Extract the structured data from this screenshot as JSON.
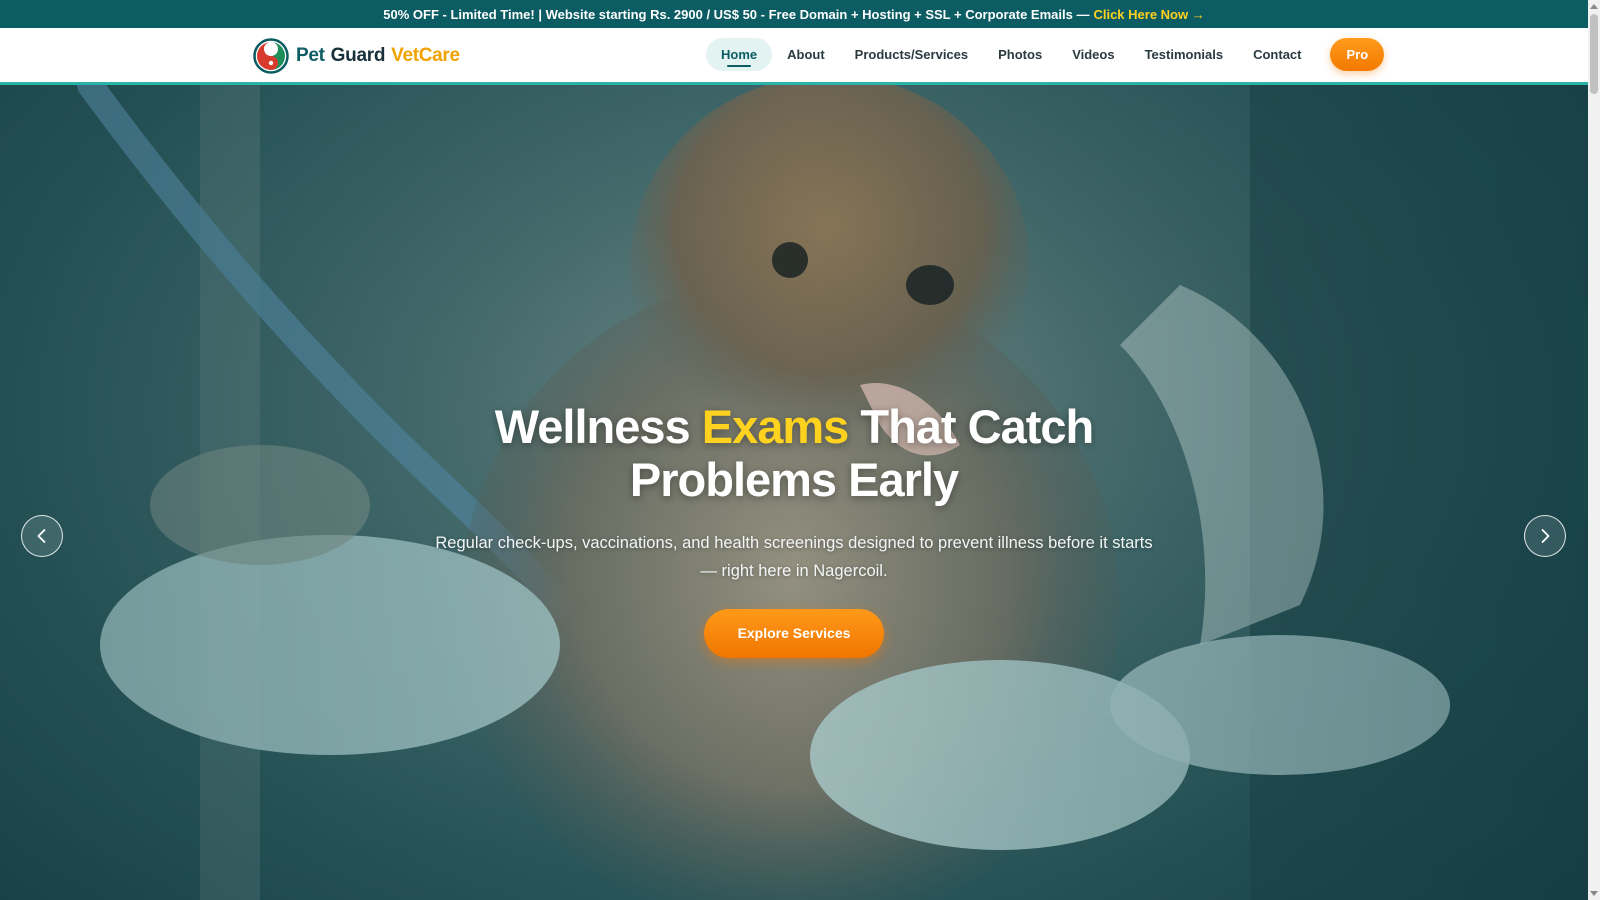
{
  "promo": {
    "text": "50% OFF - Limited Time! | Website starting Rs. 2900 / US$ 50 - Free Domain + Hosting + SSL + Corporate Emails —",
    "cta": "Click Here Now →"
  },
  "brand": {
    "word1": "Pet",
    "word2": "Guard",
    "word3": "VetCare",
    "logo_icon": "pet-guard-logo-icon"
  },
  "nav": {
    "items": [
      {
        "label": "Home",
        "active": true
      },
      {
        "label": "About"
      },
      {
        "label": "Products/Services"
      },
      {
        "label": "Photos"
      },
      {
        "label": "Videos"
      },
      {
        "label": "Testimonials"
      },
      {
        "label": "Contact"
      }
    ],
    "pro_label": "Pro"
  },
  "hero": {
    "title_part1": "Wellness",
    "title_accent": "Exams",
    "title_part2": "That Catch",
    "title_line2": "Problems Early",
    "subtitle": "Regular check-ups, vaccinations, and health screenings designed to prevent illness before it starts — right here in Nagercoil.",
    "button_label": "Explore Services",
    "prev_icon": "chevron-left-icon",
    "next_icon": "chevron-right-icon"
  },
  "colors": {
    "teal": "#0b5c63",
    "accent_teal": "#2bb3a8",
    "yellow": "#ffd21f",
    "orange": "#f27a00"
  }
}
